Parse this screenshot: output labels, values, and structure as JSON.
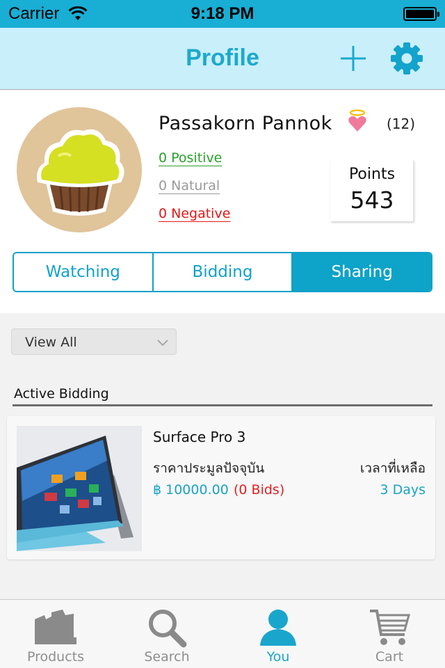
{
  "status_bar": {
    "carrier": "Carrier",
    "time": "9:18 PM",
    "wifi_icon": "wifi-icon",
    "battery_icon": "battery-icon"
  },
  "navbar": {
    "title": "Profile",
    "add_icon": "plus-icon",
    "settings_icon": "gear-icon"
  },
  "profile": {
    "name": "Passakorn  Pannok",
    "badge_icon": "angel-heart-icon",
    "badge_count": "(12)",
    "feedback": {
      "positive": "0  Positive",
      "natural": "0  Natural",
      "negative": "0  Negative"
    },
    "points": {
      "label": "Points",
      "value": "543"
    }
  },
  "segments": [
    {
      "label": "Watching",
      "active": false
    },
    {
      "label": "Bidding",
      "active": false
    },
    {
      "label": "Sharing",
      "active": true
    }
  ],
  "filter": {
    "value": "View  All"
  },
  "section": {
    "title": "Active Bidding"
  },
  "items": [
    {
      "name": "Surface  Pro  3",
      "price_label": "ราคาประมูลปัจจุบัน",
      "time_label": "เวลาที่เหลือ",
      "price": "฿  10000.00",
      "bids": "(0  Bids)",
      "time_left": "3  Days"
    }
  ],
  "tabbar": [
    {
      "label": "Products",
      "icon": "products-icon",
      "active": false
    },
    {
      "label": "Search",
      "icon": "search-icon",
      "active": false
    },
    {
      "label": "You",
      "icon": "user-icon",
      "active": true
    },
    {
      "label": "Cart",
      "icon": "cart-icon",
      "active": false
    }
  ],
  "colors": {
    "accent": "#19aed4",
    "nav_bg": "#c9effb",
    "positive": "#28a128",
    "negative": "#e01818",
    "neutral": "#9a9a9a"
  }
}
